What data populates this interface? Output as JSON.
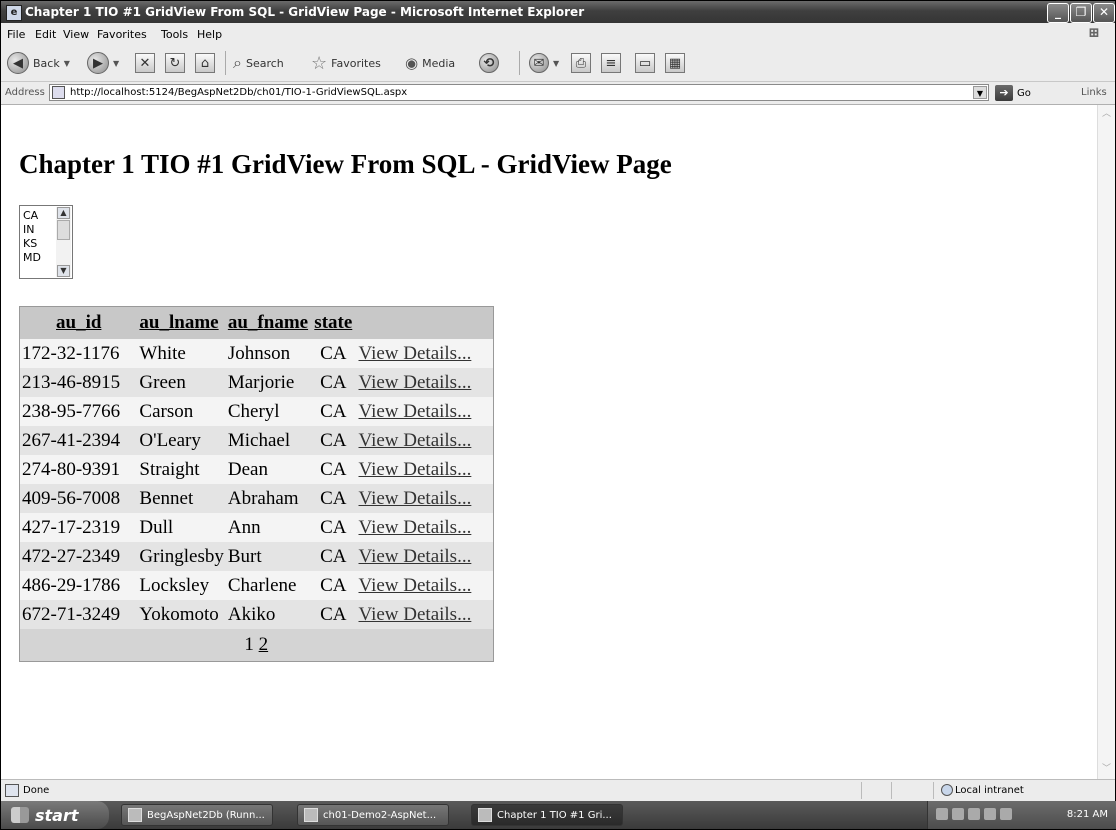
{
  "window": {
    "title": "Chapter 1 TIO #1 GridView From SQL - GridView Page - Microsoft Internet Explorer"
  },
  "menu": [
    "File",
    "Edit",
    "View",
    "Favorites",
    "Tools",
    "Help"
  ],
  "toolbar": {
    "back": "Back",
    "search": "Search",
    "favorites": "Favorites",
    "media": "Media"
  },
  "address": {
    "label": "Address",
    "url": "http://localhost:5124/BegAspNet2Db/ch01/TIO-1-GridViewSQL.aspx",
    "go": "Go",
    "links": "Links"
  },
  "page": {
    "heading": "Chapter 1 TIO #1 GridView From SQL - GridView Page",
    "states": [
      "CA",
      "IN",
      "KS",
      "MD"
    ]
  },
  "grid": {
    "headers": [
      "au_id",
      "au_lname",
      "au_fname",
      "state"
    ],
    "link_text": "View Details...",
    "rows": [
      {
        "id": "172-32-1176",
        "lname": "White",
        "fname": "Johnson",
        "state": "CA"
      },
      {
        "id": "213-46-8915",
        "lname": "Green",
        "fname": "Marjorie",
        "state": "CA"
      },
      {
        "id": "238-95-7766",
        "lname": "Carson",
        "fname": "Cheryl",
        "state": "CA"
      },
      {
        "id": "267-41-2394",
        "lname": "O'Leary",
        "fname": "Michael",
        "state": "CA"
      },
      {
        "id": "274-80-9391",
        "lname": "Straight",
        "fname": "Dean",
        "state": "CA"
      },
      {
        "id": "409-56-7008",
        "lname": "Bennet",
        "fname": "Abraham",
        "state": "CA"
      },
      {
        "id": "427-17-2319",
        "lname": "Dull",
        "fname": "Ann",
        "state": "CA"
      },
      {
        "id": "472-27-2349",
        "lname": "Gringlesby",
        "fname": "Burt",
        "state": "CA"
      },
      {
        "id": "486-29-1786",
        "lname": "Locksley",
        "fname": "Charlene",
        "state": "CA"
      },
      {
        "id": "672-71-3249",
        "lname": "Yokomoto",
        "fname": "Akiko",
        "state": "CA"
      }
    ],
    "pager": {
      "page1": "1",
      "page2": "2"
    }
  },
  "status": {
    "text": "Done",
    "zone": "Local intranet"
  },
  "taskbar": {
    "start": "start",
    "tasks": [
      "BegAspNet2Db (Runn...",
      "ch01-Demo2-AspNet...",
      "Chapter 1 TIO #1 Gri..."
    ],
    "clock": "8:21 AM"
  }
}
